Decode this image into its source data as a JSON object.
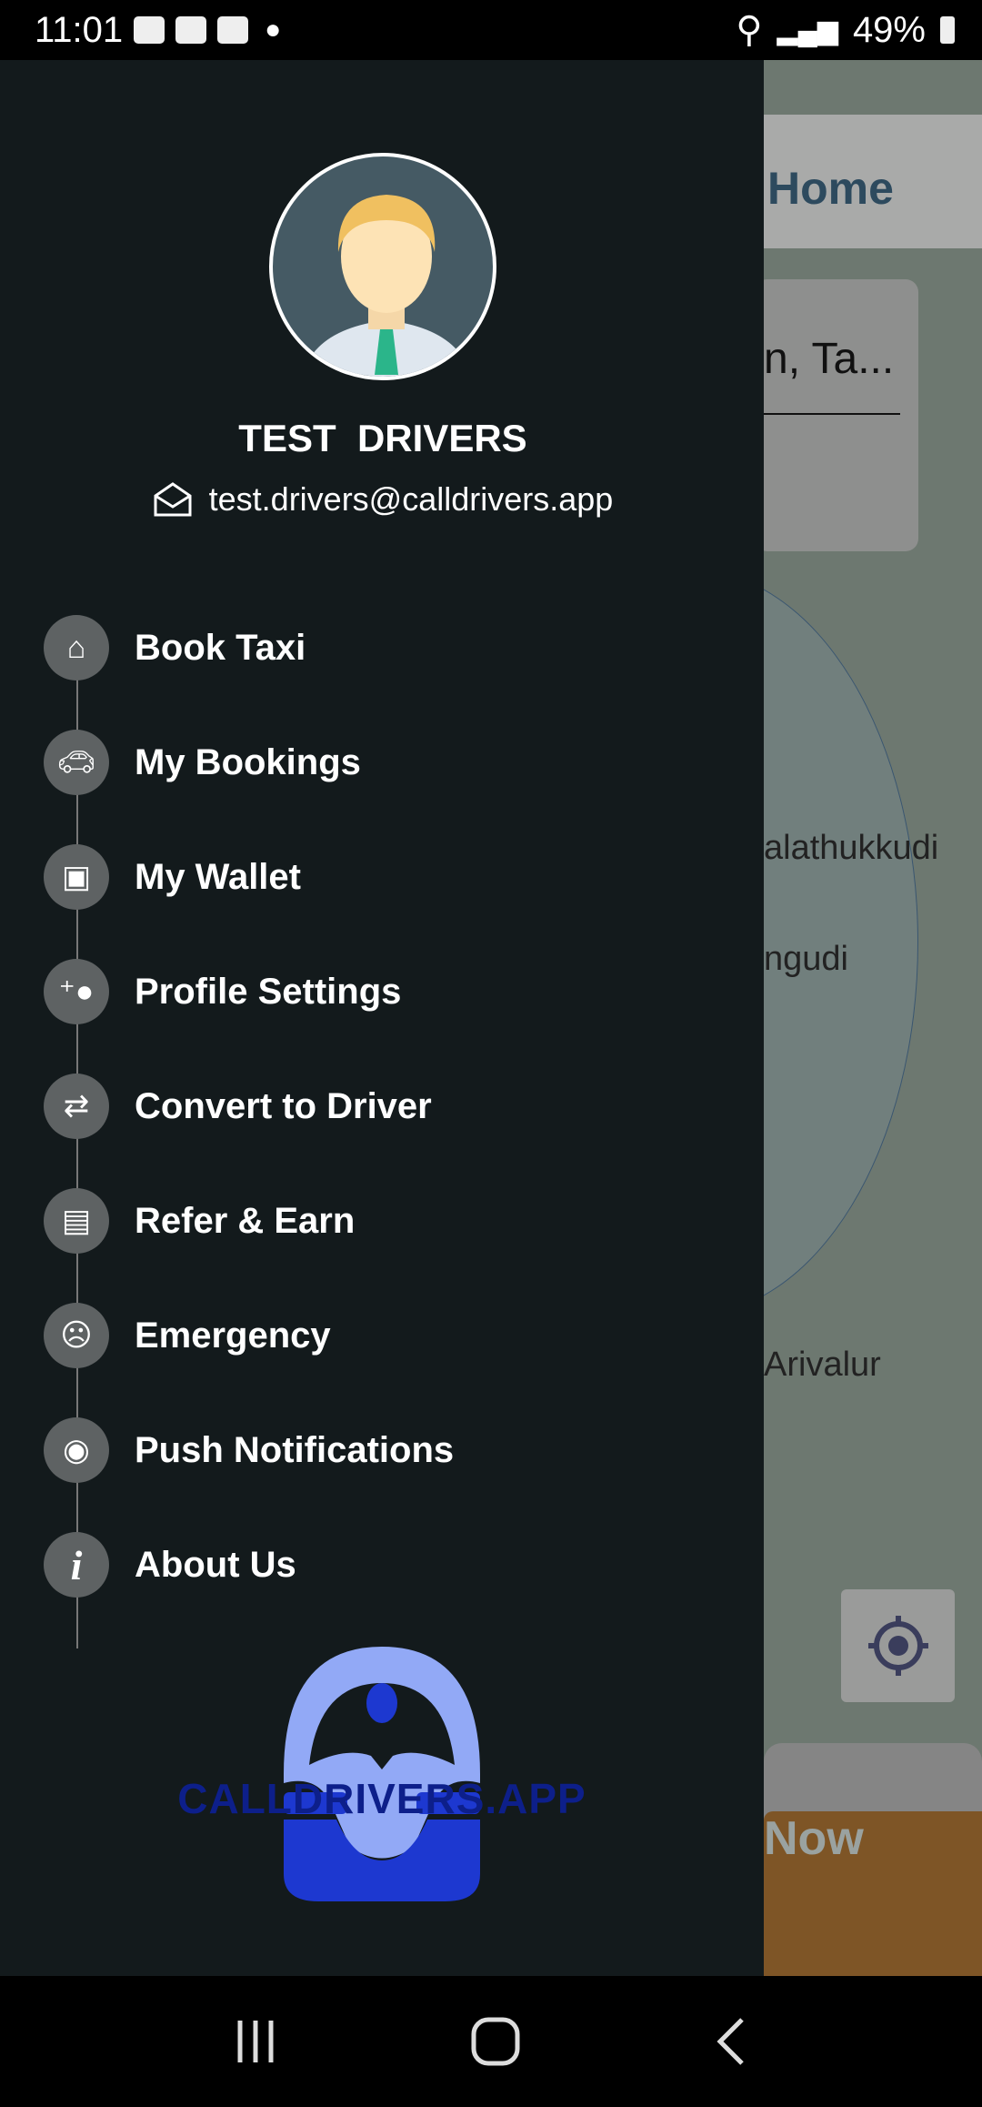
{
  "status_bar": {
    "time": "11:01",
    "battery": "49%",
    "icons": [
      "youtube-icon",
      "gallery-icon",
      "linkedin-icon",
      "dot-icon",
      "recycle-icon",
      "alarm-icon",
      "location-icon",
      "wifi-icon",
      "signal-icon",
      "battery-icon"
    ]
  },
  "background": {
    "header_title": "Home",
    "search_text": "n, Ta...",
    "map_labels": [
      "alathukkudi",
      "ngudi",
      "Arivalur"
    ],
    "button_label": "Now",
    "colors": {
      "button": "#7e5526",
      "map": "#6d7870"
    }
  },
  "drawer": {
    "user_name": "TEST  DRIVERS",
    "email": "test.drivers@calldrivers.app",
    "menu": [
      {
        "label": "Book Taxi",
        "icon": "home-icon"
      },
      {
        "label": "My Bookings",
        "icon": "car-icon"
      },
      {
        "label": "My Wallet",
        "icon": "wallet-icon"
      },
      {
        "label": "Profile Settings",
        "icon": "user-plus-icon"
      },
      {
        "label": "Convert to Driver",
        "icon": "swap-icon"
      },
      {
        "label": "Refer & Earn",
        "icon": "money-icon"
      },
      {
        "label": "Emergency",
        "icon": "sad-face-icon"
      },
      {
        "label": "Push Notifications",
        "icon": "bell-icon"
      },
      {
        "label": "About Us",
        "icon": "info-icon"
      }
    ],
    "logo_text": "CALLDRIVERS.APP",
    "colors": {
      "background": "#131a1c",
      "logo_light": "#92a9f6",
      "logo_dark": "#1d38d0"
    }
  }
}
